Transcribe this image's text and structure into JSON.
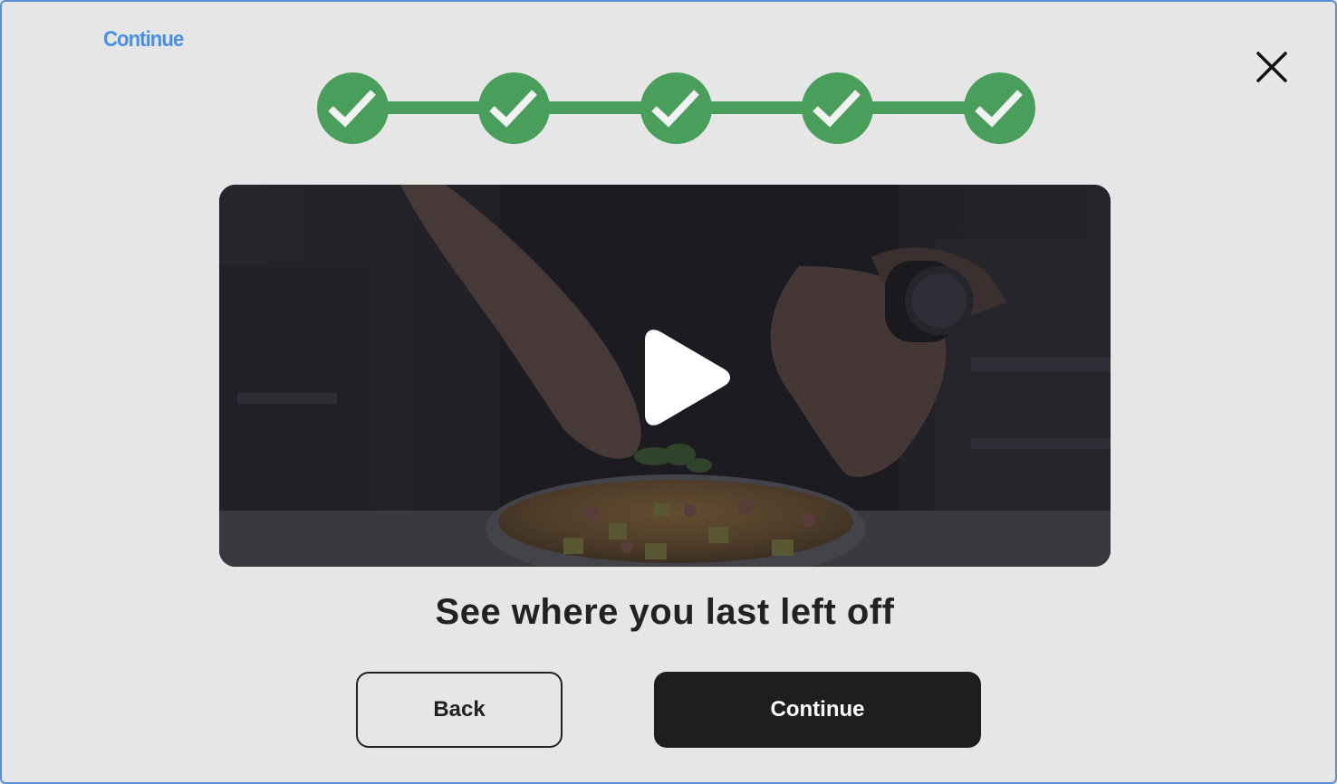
{
  "header": {
    "corner_label": "Continue"
  },
  "close_icon": "close-icon",
  "stepper": {
    "total_steps": 5,
    "completed_steps": 5,
    "color": "#4a9e5c",
    "step_icon": "checkmark-icon"
  },
  "video": {
    "play_icon": "play-icon"
  },
  "main": {
    "heading": "See where you last left off"
  },
  "actions": {
    "back_label": "Back",
    "continue_label": "Continue"
  },
  "colors": {
    "background": "#e6e6e6",
    "primary_button": "#1e1e1e",
    "accent_label": "#4a8fe0",
    "success": "#4a9e5c"
  }
}
